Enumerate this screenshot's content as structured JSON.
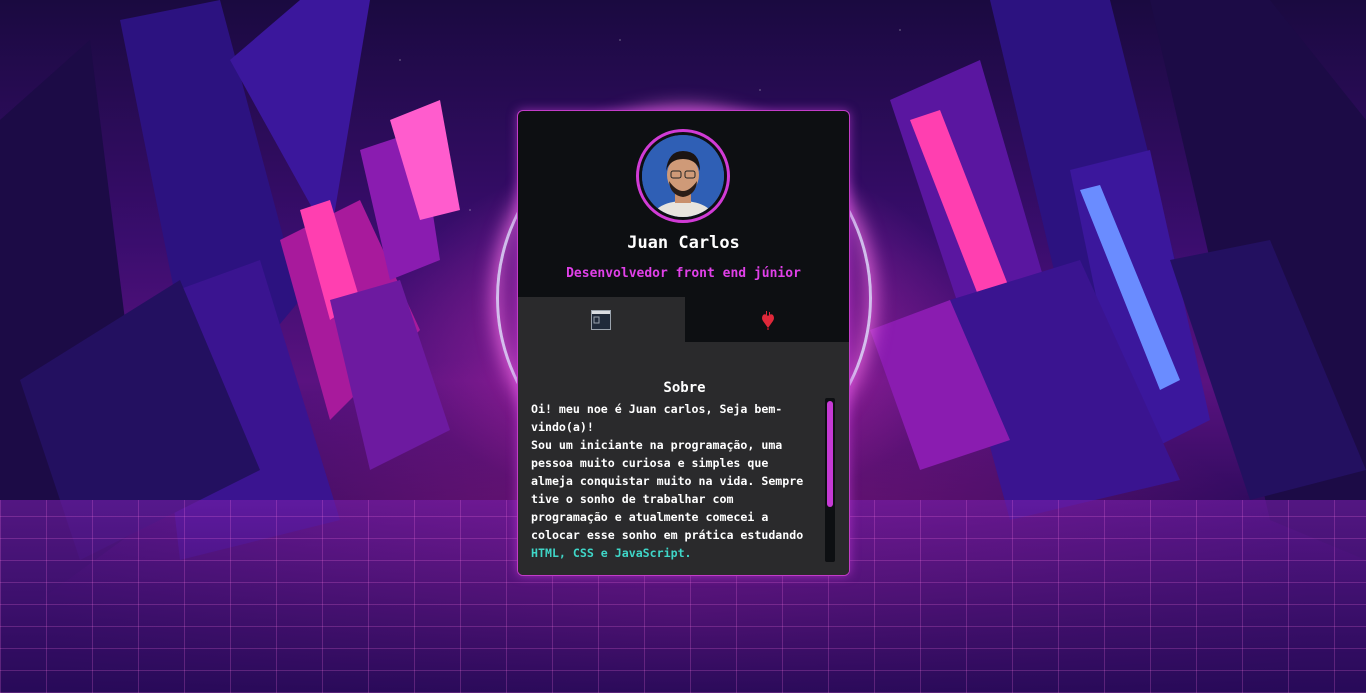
{
  "profile": {
    "name": "Juan Carlos",
    "role": "Desenvolvedor front end júnior"
  },
  "tabs": [
    {
      "icon": "window-icon",
      "active": true
    },
    {
      "icon": "heart-icon",
      "active": false
    }
  ],
  "about": {
    "title": "Sobre",
    "line1": "Oi! meu noe é Juan carlos, Seja bem-vindo(a)!",
    "line2": "Sou um iniciante na programação, uma pessoa muito curiosa e simples que almeja conquistar muito na vida. Sempre tive o sonho de trabalhar com programação e atualmente comecei a colocar esse sonho em prática estudando ",
    "highlight": "HTML, CSS e JavaScript."
  },
  "colors": {
    "accent": "#d13bd6",
    "highlight": "#3fd6c8",
    "card_bg": "#0d0f12",
    "panel_bg": "#2a2a2c"
  }
}
